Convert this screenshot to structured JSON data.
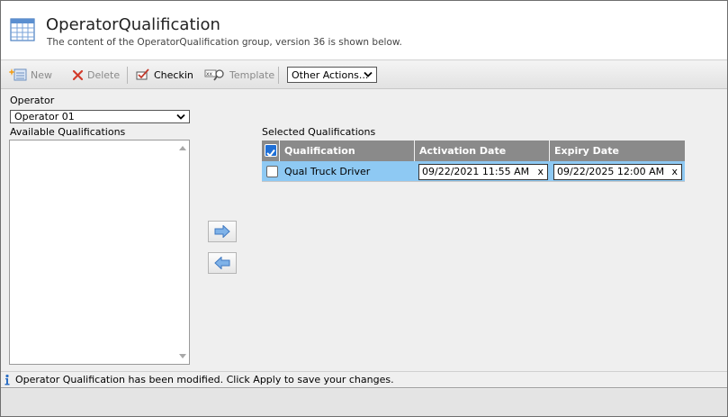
{
  "header": {
    "title": "OperatorQualification",
    "subtitle": "The content of the OperatorQualification group, version 36 is shown below.",
    "icon": "table-grid-icon"
  },
  "toolbar": {
    "new_label": "New",
    "delete_label": "Delete",
    "checkin_label": "Checkin",
    "template_label": "Template",
    "other_actions_label": "Other Actions..."
  },
  "operator": {
    "label": "Operator",
    "selected": "Operator 01"
  },
  "available": {
    "label": "Available Qualifications",
    "items": []
  },
  "selected": {
    "label": "Selected Qualifications",
    "columns": [
      "Qualification",
      "Activation Date",
      "Expiry Date"
    ],
    "rows": [
      {
        "checked": false,
        "qualification": "Qual Truck Driver",
        "activation_date": "09/22/2021 11:55 AM",
        "expiry_date": "09/22/2025 12:00 AM"
      }
    ],
    "clear_symbol": "x"
  },
  "status": {
    "message": "Operator Qualification has been modified. Click Apply to save your changes."
  },
  "colors": {
    "accent_blue": "#1f6fd6",
    "row_highlight": "#8ec9f3",
    "grid_header": "#8a8a8a",
    "delete_red": "#d23a2a"
  }
}
